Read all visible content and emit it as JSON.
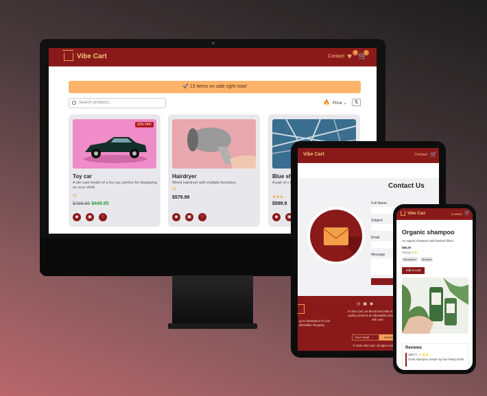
{
  "desktop": {
    "brand": "Vibe Cart",
    "nav_contact": "Contact",
    "wishlist_count": "1",
    "cart_count": "1",
    "banner": "🚀 13 items on sale right now!",
    "search_placeholder": "Search products...",
    "sort_label": "Price",
    "products": [
      {
        "title": "Toy car",
        "description": "A die-cast model of a toy car, perfect for displaying on your shelf.",
        "old_price": "$499.95",
        "price": "$449.95",
        "badge": "10% OFF",
        "rating": "(0)"
      },
      {
        "title": "Hairdryer",
        "description": "Wired hairdryer with multiple functions.",
        "price": "$579.99",
        "rating": "(0)"
      },
      {
        "title": "Blue sh",
        "description": "A pair of s formal ano",
        "price": "$599.9"
      }
    ]
  },
  "tablet": {
    "brand": "Vibe Cart",
    "nav_contact": "Contact",
    "heading": "Contact Us",
    "labels": [
      "Full Name",
      "Subject",
      "Email",
      "Message"
    ],
    "footer_left": "go-to destination for and affordable shopping.",
    "footer_text": "At Vibe Cart, we blend trend with trust. Discover quality products at unbeatable prices, delivered with care.",
    "email_placeholder": "Your email",
    "subscribe": "Subscribe",
    "copyright": "© 2025 Vibe Cart. All rights reserved."
  },
  "phone": {
    "brand": "Vibe Cart",
    "nav_contact": "Contact",
    "title": "Organic shampoo",
    "subtitle": "An organic shampoo with bamboo fibres.",
    "price": "$59.29",
    "rating": "Rating: 5 ⭐",
    "tags": [
      "#shampoo",
      "#beauty"
    ],
    "add_button": "Add to Cart",
    "reviews_heading": "Reviews",
    "review_author": "John T. — ⭐⭐",
    "review_text": "Great shampoo, keeps my hair feeling fresh."
  }
}
